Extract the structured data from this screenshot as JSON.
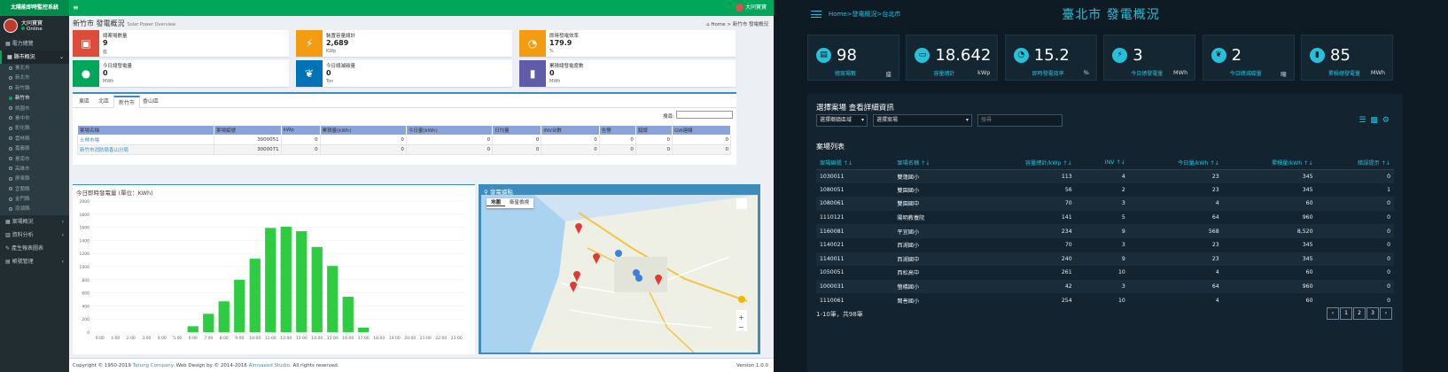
{
  "left": {
    "brand": "太陽能即時監控系統",
    "menu_icon": "hamburger-icon",
    "top_user": "大同寶寶",
    "sidebar": {
      "user_name": "大同寶寶",
      "user_status": "Online",
      "items": [
        {
          "label": "電力總覽"
        },
        {
          "label": "縣市概況"
        }
      ],
      "subitems": [
        "臺北市",
        "新北市",
        "新竹縣",
        "新竹市",
        "桃園市",
        "臺中市",
        "彰化縣",
        "雲林縣",
        "嘉義縣",
        "臺南市",
        "高雄市",
        "屏東縣",
        "宜蘭縣",
        "金門縣",
        "澎湖縣"
      ],
      "active_sub": "新竹市",
      "bottom_items": [
        {
          "label": "案場概況"
        },
        {
          "label": "資料分析"
        },
        {
          "label": "產生報表圖表"
        },
        {
          "label": "帳號管理"
        }
      ]
    },
    "page_title": "新竹市 發電概況",
    "page_subtitle": "Solar Power Overview",
    "breadcrumb_home": "Home",
    "breadcrumb_current": "新竹市 發電概況",
    "info_boxes": [
      {
        "label": "總案場數量",
        "value": "9",
        "unit": "座",
        "color": "#dd4b39",
        "icon": "cube-icon"
      },
      {
        "label": "裝置容量總計",
        "value": "2,689",
        "unit": "KWp",
        "color": "#f39c12",
        "icon": "bolt-icon"
      },
      {
        "label": "即時發電效率",
        "value": "179.9",
        "unit": "%",
        "color": "#f39c12",
        "icon": "gauge-icon"
      },
      {
        "label": "今日總發電量",
        "value": "0",
        "unit": "MWh",
        "color": "#00a65a",
        "icon": "bulb-icon"
      },
      {
        "label": "今日總減碳量",
        "value": "0",
        "unit": "Ton",
        "color": "#0073b7",
        "icon": "leaf-icon"
      },
      {
        "label": "累積總發電度數",
        "value": "0",
        "unit": "MWh",
        "color": "#605ca8",
        "icon": "bar-chart-icon"
      }
    ],
    "tabs": [
      "東區",
      "北區",
      "新竹市",
      "香山區"
    ],
    "search_label": "搜尋:",
    "table": {
      "headers": [
        "案場名稱",
        "案場編號",
        "kWp",
        "累積量(kWh)",
        "今日量(kWh)",
        "日均量",
        "INV台數",
        "告警",
        "錯誤",
        "GW連線"
      ],
      "rows": [
        [
          "士林市場",
          "3000051",
          "0",
          "0",
          "0",
          "0",
          "0",
          "0",
          "0",
          "0"
        ],
        [
          "新竹市消防局香山分局",
          "3000071",
          "0",
          "0",
          "0",
          "0",
          "0",
          "0",
          "0",
          "0"
        ]
      ]
    },
    "chart_title": "今日即時發電量 (單位：KWh)",
    "map_title": "發電據點",
    "map_btn_map": "地圖",
    "map_btn_sat": "衛星檢視",
    "footer_left_pre": "Copyright © 1950-2019 ",
    "footer_company": "Tatung Company",
    "footer_mid": ". Web Design by © 2014-2016 ",
    "footer_studio": "Almsaeed Studio",
    "footer_end": ". All rights reserved.",
    "footer_version": "Version 1.0.0",
    "chart_data": {
      "type": "bar",
      "title": "今日即時發電量 (單位：KWh)",
      "categories": [
        "0:00",
        "1:00",
        "2:00",
        "3:00",
        "4:00",
        "5:00",
        "6:00",
        "7:00",
        "8:00",
        "9:00",
        "10:00",
        "11:00",
        "12:00",
        "13:00",
        "14:00",
        "15:00",
        "16:00",
        "17:00",
        "18:00",
        "19:00",
        "20:00",
        "21:00",
        "22:00",
        "23:00"
      ],
      "values": [
        0,
        0,
        0,
        0,
        0,
        0,
        90,
        280,
        470,
        800,
        1120,
        1590,
        1610,
        1540,
        1300,
        1010,
        540,
        70,
        0,
        0,
        0,
        0,
        0,
        0
      ],
      "yticks": [
        0,
        200,
        400,
        600,
        800,
        1000,
        1200,
        1400,
        1600,
        1800,
        2000
      ],
      "ylim": [
        0,
        2000
      ],
      "color": "#2ecc40"
    }
  },
  "right": {
    "breadcrumb": "Home>發電概況>台北市",
    "title": "臺北市 發電概況",
    "kpis": [
      {
        "value": "98",
        "label": "總案場數",
        "unit": "座",
        "icon": "site-icon"
      },
      {
        "value": "18.642",
        "label": "容量總計",
        "unit": "kWp",
        "icon": "battery-icon"
      },
      {
        "value": "15.2",
        "label": "即時發電效率",
        "unit": "%",
        "icon": "gauge-icon"
      },
      {
        "value": "3",
        "label": "今日總發電量",
        "unit": "MWh",
        "icon": "bolt-icon"
      },
      {
        "value": "2",
        "label": "今日總減碳量",
        "unit": "噸",
        "icon": "leaf-icon"
      },
      {
        "value": "85",
        "label": "累積總發電量",
        "unit": "MWh",
        "icon": "bar-chart-icon"
      }
    ],
    "select_title": "選擇案場 查看詳細資訊",
    "select_district": "選擇鄉鎮區域",
    "select_site": "選擇案場",
    "search_placeholder": "搜尋",
    "list_title": "案場列表",
    "table_headers": [
      "案場編號 ↑↓",
      "案場名稱 ↑↓",
      "容量總計/kWp ↑↓",
      "INV ↑↓",
      "今日量/kWh ↑↓",
      "累積量/kWh ↑↓",
      "錯誤提示 ↑↓"
    ],
    "rows": [
      [
        "1030011",
        "雙蓮國小",
        "113",
        "4",
        "23",
        "345",
        "0"
      ],
      [
        "1080051",
        "雙園國小",
        "56",
        "2",
        "23",
        "345",
        "1"
      ],
      [
        "1080061",
        "雙園國中",
        "70",
        "3",
        "4",
        "60",
        "0"
      ],
      [
        "1110121",
        "陽明教養院",
        "141",
        "5",
        "64",
        "960",
        "0"
      ],
      [
        "1160081",
        "平宜國小",
        "234",
        "9",
        "568",
        "8,520",
        "0"
      ],
      [
        "1140021",
        "西湖國小",
        "70",
        "3",
        "23",
        "345",
        "0"
      ],
      [
        "1140011",
        "西湖國中",
        "240",
        "9",
        "23",
        "345",
        "0"
      ],
      [
        "1050051",
        "西松高中",
        "261",
        "10",
        "4",
        "60",
        "0"
      ],
      [
        "1000031",
        "螢橋國小",
        "42",
        "3",
        "64",
        "960",
        "0"
      ],
      [
        "1110061",
        "閩善國小",
        "254",
        "10",
        "4",
        "60",
        "0"
      ]
    ],
    "info": "1-10筆，共98筆",
    "pager": [
      "‹",
      "1",
      "2",
      "3",
      "›"
    ]
  }
}
